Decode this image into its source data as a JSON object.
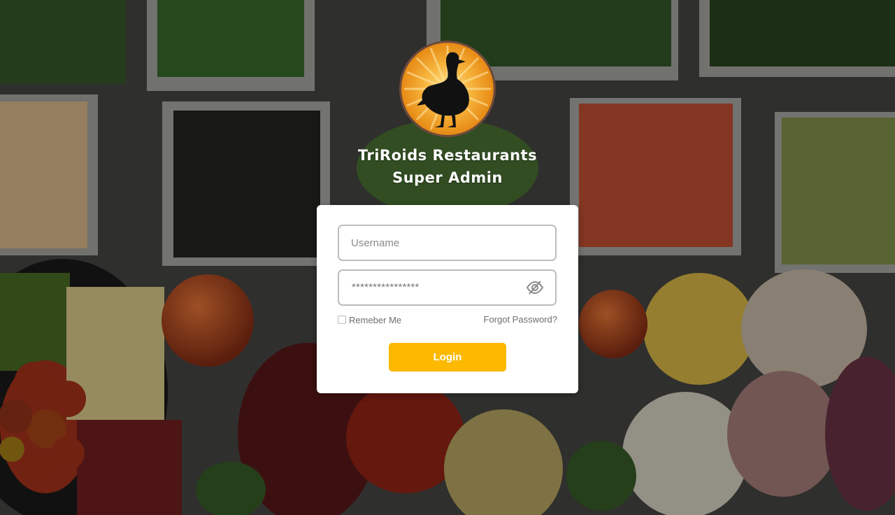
{
  "brand": {
    "name_line": "TriRoids Restaurants",
    "role_line": "Super Admin",
    "logo_icon": "goose-sunburst-logo"
  },
  "login_form": {
    "username_placeholder": "Username",
    "username_value": "",
    "password_value": "****************",
    "password_toggle_icon": "eye-slash-icon",
    "remember_label": "Remeber Me",
    "remember_checked": false,
    "forgot_label": "Forgot Password?",
    "submit_label": "Login"
  },
  "colors": {
    "accent": "#fcb900",
    "card_background": "#ffffff",
    "field_border": "#bdbdbd",
    "logo_orange": "#f2a21c"
  }
}
